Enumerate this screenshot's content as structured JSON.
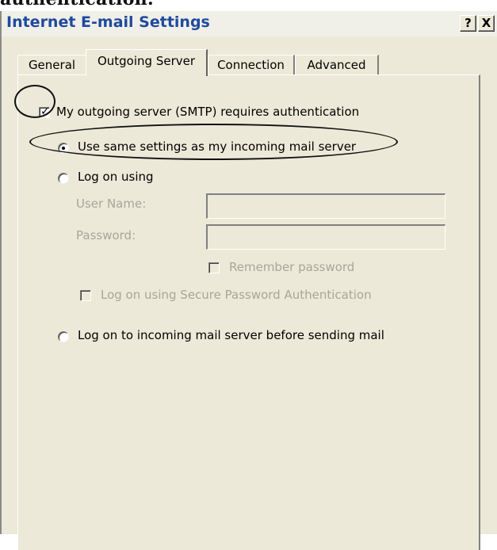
{
  "heading_fragment": "authentication.",
  "window": {
    "title": "Internet E-mail Settings",
    "help_label": "?",
    "close_label": "X"
  },
  "tabs": [
    {
      "label": "General",
      "active": false
    },
    {
      "label": "Outgoing Server",
      "active": true
    },
    {
      "label": "Connection",
      "active": false
    },
    {
      "label": "Advanced",
      "active": false
    }
  ],
  "outgoing": {
    "requires_auth_label": "My outgoing server (SMTP) requires authentication",
    "requires_auth_checked": true,
    "use_same_label": "Use same settings as my incoming mail server",
    "use_same_selected": true,
    "log_on_using_label": "Log on using",
    "log_on_using_selected": false,
    "user_name_label": "User Name:",
    "user_name_value": "",
    "password_label": "Password:",
    "password_value": "",
    "remember_password_label": "Remember password",
    "remember_password_checked": false,
    "spa_label": "Log on using Secure Password Authentication",
    "spa_checked": false,
    "log_on_incoming_label": "Log on to incoming mail server before sending mail",
    "log_on_incoming_selected": false
  },
  "colors": {
    "dialog_bg": "#ece9d8",
    "title_text": "#1f4a9e",
    "disabled_text": "#a7a69a"
  }
}
